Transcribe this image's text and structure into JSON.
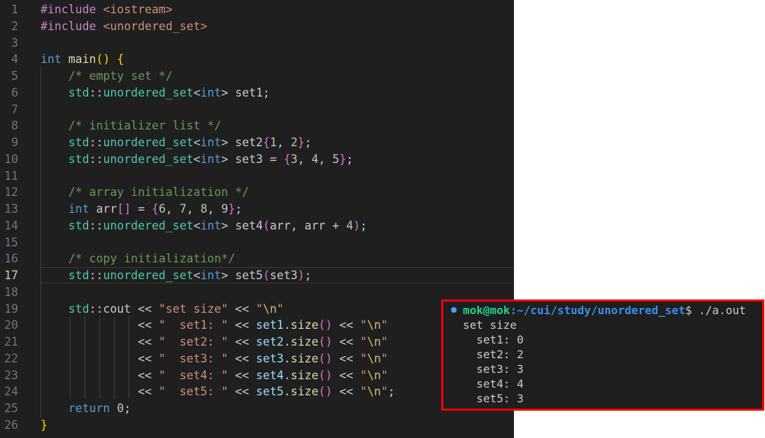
{
  "editor": {
    "line_numbers": [
      "1",
      "2",
      "3",
      "4",
      "5",
      "6",
      "7",
      "8",
      "9",
      "10",
      "11",
      "12",
      "13",
      "14",
      "15",
      "16",
      "17",
      "18",
      "19",
      "20",
      "21",
      "22",
      "23",
      "24",
      "25",
      "26"
    ],
    "active_line": "17"
  },
  "terminal": {
    "prompt_user": "mok@mok",
    "prompt_path": ":~/cui/study/unordered_set",
    "prompt_symbol": "$",
    "command": " ./a.out",
    "output": [
      "set size",
      "  set1: 0",
      "  set2: 2",
      "  set3: 3",
      "  set4: 4",
      "  set5: 3"
    ]
  },
  "colors": {
    "editor_bg": "#1f1f1f",
    "keyword": "#569cd6",
    "comment": "#6a9955",
    "string": "#ce9178",
    "highlight_border": "#ff0000"
  }
}
